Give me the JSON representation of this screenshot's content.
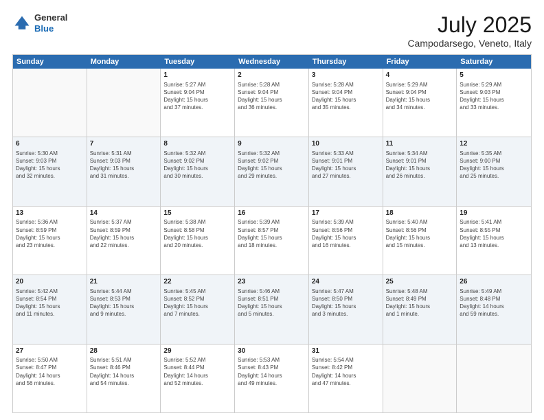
{
  "logo": {
    "general": "General",
    "blue": "Blue"
  },
  "title": {
    "month_year": "July 2025",
    "location": "Campodarsego, Veneto, Italy"
  },
  "header_days": [
    "Sunday",
    "Monday",
    "Tuesday",
    "Wednesday",
    "Thursday",
    "Friday",
    "Saturday"
  ],
  "weeks": [
    [
      {
        "day": "",
        "info": ""
      },
      {
        "day": "",
        "info": ""
      },
      {
        "day": "1",
        "info": "Sunrise: 5:27 AM\nSunset: 9:04 PM\nDaylight: 15 hours\nand 37 minutes."
      },
      {
        "day": "2",
        "info": "Sunrise: 5:28 AM\nSunset: 9:04 PM\nDaylight: 15 hours\nand 36 minutes."
      },
      {
        "day": "3",
        "info": "Sunrise: 5:28 AM\nSunset: 9:04 PM\nDaylight: 15 hours\nand 35 minutes."
      },
      {
        "day": "4",
        "info": "Sunrise: 5:29 AM\nSunset: 9:04 PM\nDaylight: 15 hours\nand 34 minutes."
      },
      {
        "day": "5",
        "info": "Sunrise: 5:29 AM\nSunset: 9:03 PM\nDaylight: 15 hours\nand 33 minutes."
      }
    ],
    [
      {
        "day": "6",
        "info": "Sunrise: 5:30 AM\nSunset: 9:03 PM\nDaylight: 15 hours\nand 32 minutes."
      },
      {
        "day": "7",
        "info": "Sunrise: 5:31 AM\nSunset: 9:03 PM\nDaylight: 15 hours\nand 31 minutes."
      },
      {
        "day": "8",
        "info": "Sunrise: 5:32 AM\nSunset: 9:02 PM\nDaylight: 15 hours\nand 30 minutes."
      },
      {
        "day": "9",
        "info": "Sunrise: 5:32 AM\nSunset: 9:02 PM\nDaylight: 15 hours\nand 29 minutes."
      },
      {
        "day": "10",
        "info": "Sunrise: 5:33 AM\nSunset: 9:01 PM\nDaylight: 15 hours\nand 27 minutes."
      },
      {
        "day": "11",
        "info": "Sunrise: 5:34 AM\nSunset: 9:01 PM\nDaylight: 15 hours\nand 26 minutes."
      },
      {
        "day": "12",
        "info": "Sunrise: 5:35 AM\nSunset: 9:00 PM\nDaylight: 15 hours\nand 25 minutes."
      }
    ],
    [
      {
        "day": "13",
        "info": "Sunrise: 5:36 AM\nSunset: 8:59 PM\nDaylight: 15 hours\nand 23 minutes."
      },
      {
        "day": "14",
        "info": "Sunrise: 5:37 AM\nSunset: 8:59 PM\nDaylight: 15 hours\nand 22 minutes."
      },
      {
        "day": "15",
        "info": "Sunrise: 5:38 AM\nSunset: 8:58 PM\nDaylight: 15 hours\nand 20 minutes."
      },
      {
        "day": "16",
        "info": "Sunrise: 5:39 AM\nSunset: 8:57 PM\nDaylight: 15 hours\nand 18 minutes."
      },
      {
        "day": "17",
        "info": "Sunrise: 5:39 AM\nSunset: 8:56 PM\nDaylight: 15 hours\nand 16 minutes."
      },
      {
        "day": "18",
        "info": "Sunrise: 5:40 AM\nSunset: 8:56 PM\nDaylight: 15 hours\nand 15 minutes."
      },
      {
        "day": "19",
        "info": "Sunrise: 5:41 AM\nSunset: 8:55 PM\nDaylight: 15 hours\nand 13 minutes."
      }
    ],
    [
      {
        "day": "20",
        "info": "Sunrise: 5:42 AM\nSunset: 8:54 PM\nDaylight: 15 hours\nand 11 minutes."
      },
      {
        "day": "21",
        "info": "Sunrise: 5:44 AM\nSunset: 8:53 PM\nDaylight: 15 hours\nand 9 minutes."
      },
      {
        "day": "22",
        "info": "Sunrise: 5:45 AM\nSunset: 8:52 PM\nDaylight: 15 hours\nand 7 minutes."
      },
      {
        "day": "23",
        "info": "Sunrise: 5:46 AM\nSunset: 8:51 PM\nDaylight: 15 hours\nand 5 minutes."
      },
      {
        "day": "24",
        "info": "Sunrise: 5:47 AM\nSunset: 8:50 PM\nDaylight: 15 hours\nand 3 minutes."
      },
      {
        "day": "25",
        "info": "Sunrise: 5:48 AM\nSunset: 8:49 PM\nDaylight: 15 hours\nand 1 minute."
      },
      {
        "day": "26",
        "info": "Sunrise: 5:49 AM\nSunset: 8:48 PM\nDaylight: 14 hours\nand 59 minutes."
      }
    ],
    [
      {
        "day": "27",
        "info": "Sunrise: 5:50 AM\nSunset: 8:47 PM\nDaylight: 14 hours\nand 56 minutes."
      },
      {
        "day": "28",
        "info": "Sunrise: 5:51 AM\nSunset: 8:46 PM\nDaylight: 14 hours\nand 54 minutes."
      },
      {
        "day": "29",
        "info": "Sunrise: 5:52 AM\nSunset: 8:44 PM\nDaylight: 14 hours\nand 52 minutes."
      },
      {
        "day": "30",
        "info": "Sunrise: 5:53 AM\nSunset: 8:43 PM\nDaylight: 14 hours\nand 49 minutes."
      },
      {
        "day": "31",
        "info": "Sunrise: 5:54 AM\nSunset: 8:42 PM\nDaylight: 14 hours\nand 47 minutes."
      },
      {
        "day": "",
        "info": ""
      },
      {
        "day": "",
        "info": ""
      }
    ]
  ],
  "alt_rows": [
    1,
    3
  ]
}
